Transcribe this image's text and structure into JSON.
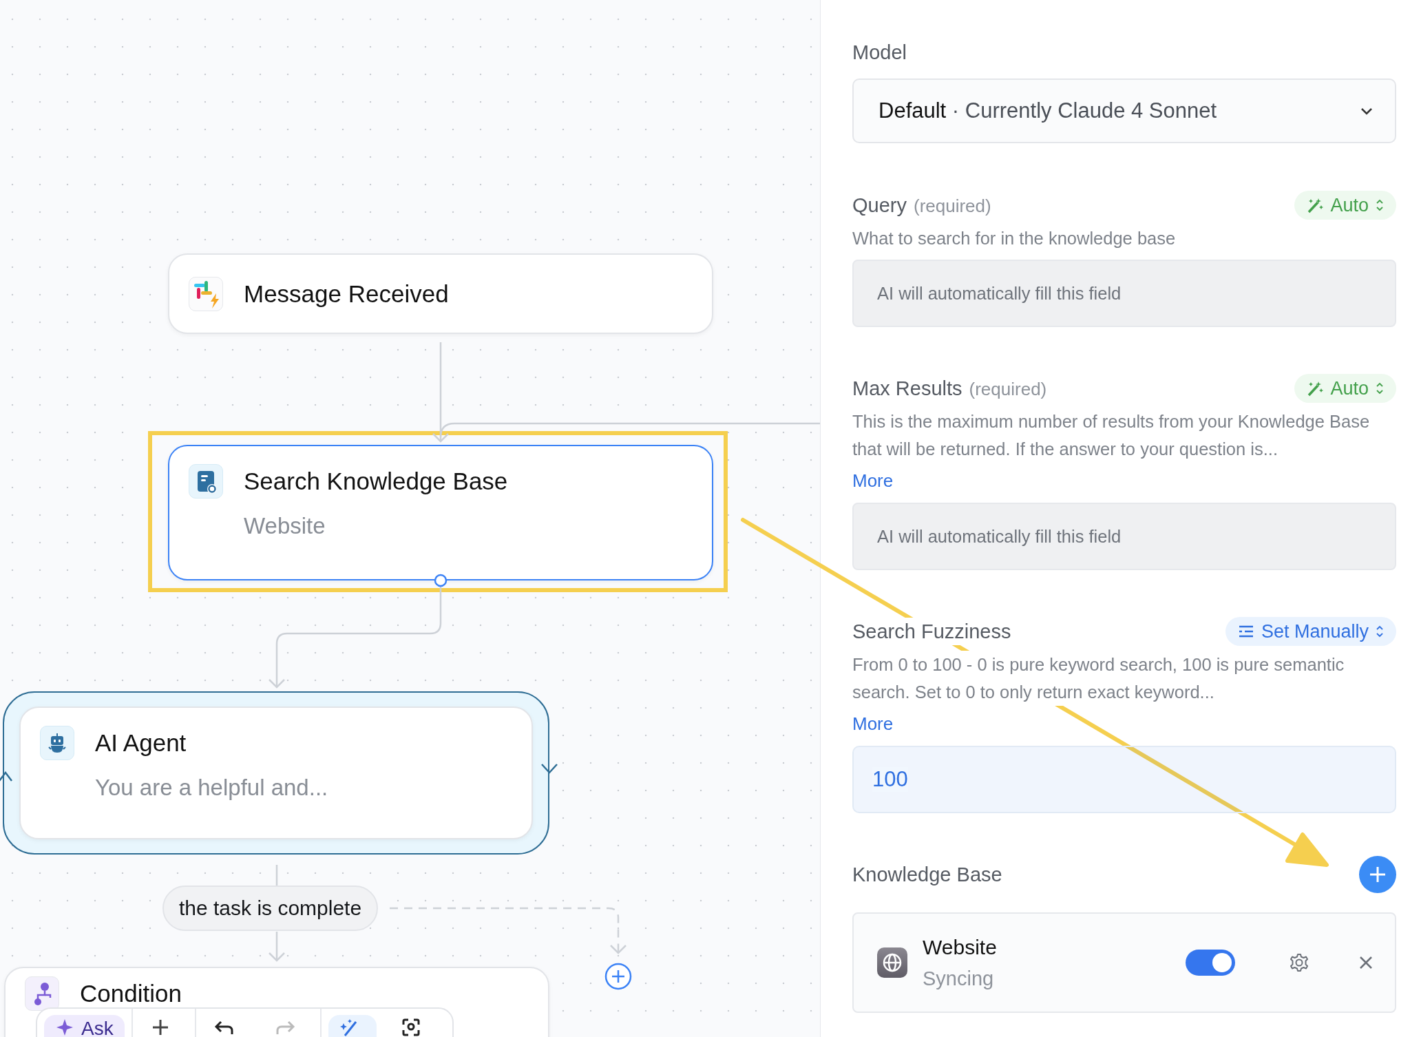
{
  "canvas": {
    "nodes": [
      {
        "kind": "trigger",
        "title": "Message Received",
        "selected": false,
        "highlighted": false
      },
      {
        "kind": "knowledge",
        "title": "Search Knowledge Base",
        "subtitle": "Website",
        "selected": true,
        "highlighted": true
      },
      {
        "kind": "agent",
        "title": "AI Agent",
        "subtitle": "You are a helpful and...",
        "selected": false,
        "highlighted": false
      },
      {
        "kind": "condition",
        "title": "Condition",
        "selected": false,
        "highlighted": false
      }
    ],
    "edge_label": "the task is complete",
    "annotation_arrow": true,
    "toolbar": [
      {
        "kind": "ask",
        "label": "Ask",
        "active": false,
        "disabled": false
      },
      {
        "kind": "add",
        "active": false,
        "disabled": false
      },
      {
        "kind": "undo",
        "active": false,
        "disabled": false
      },
      {
        "kind": "redo",
        "active": false,
        "disabled": true
      },
      {
        "kind": "wand",
        "active": true,
        "disabled": false
      },
      {
        "kind": "focus",
        "active": false,
        "disabled": false
      }
    ]
  },
  "panel": {
    "model": {
      "label": "Model",
      "value": "**Default** · Currently Claude 4 Sonnet"
    },
    "params": [
      {
        "label": "Query",
        "note": "(required)",
        "mode": {
          "kind": "auto",
          "label": "Auto"
        },
        "description": "What to search for in the knowledge base",
        "field": {
          "kind": "chip",
          "text": "AI will automatically fill this field"
        }
      },
      {
        "label": "Max Results",
        "note": "(required)",
        "mode": {
          "kind": "auto",
          "label": "Auto"
        },
        "description": "This is the maximum number of results from your Knowledge Base that will be returned. If the answer to your question is...",
        "more": "More",
        "field": {
          "kind": "chip",
          "text": "AI will automatically fill this field"
        }
      },
      {
        "label": "Search Fuzziness",
        "mode": {
          "kind": "manual",
          "label": "Set Manually"
        },
        "description": "From 0 to 100 - 0 is pure keyword search, 100 is pure semantic search. Set to 0 to only return exact keyword...",
        "more": "More",
        "field": {
          "kind": "value",
          "text": "100"
        }
      }
    ],
    "knowledge_base": {
      "label": "Knowledge Base",
      "items": [
        {
          "name": "Website",
          "status": "Syncing",
          "enabled": true
        }
      ]
    }
  }
}
